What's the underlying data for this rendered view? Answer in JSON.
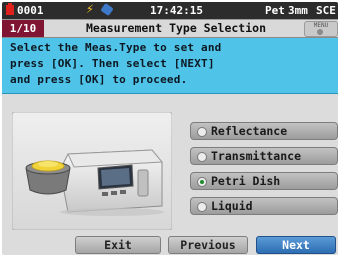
{
  "status_bar": {
    "count": "0001",
    "time": "17:42:15",
    "weekday": "Pet",
    "month": "3mm",
    "extra": "SCE",
    "colors": {
      "battery": "#e0201c",
      "bolt": "#f6c325",
      "plug": "#3e78c8"
    },
    "icons": [
      "battery-icon",
      "lightning-icon",
      "plug-icon"
    ]
  },
  "title_bar": {
    "page": "1/10",
    "title": "Measurement Type Selection",
    "menu_label": "MENU"
  },
  "instruction": {
    "lines": [
      "Select the Meas.Type to set and",
      "press [OK]. Then select [NEXT]",
      "and press [OK] to proceed."
    ]
  },
  "options": [
    {
      "label": "Reflectance",
      "selected": false
    },
    {
      "label": "Transmittance",
      "selected": false
    },
    {
      "label": "Petri Dish",
      "selected": true
    },
    {
      "label": "Liquid",
      "selected": false
    }
  ],
  "buttons": {
    "exit": "Exit",
    "previous": "Previous",
    "next": "Next"
  },
  "colors": {
    "page_badge": "#7f1433",
    "instruction_bg": "#4fc3e8",
    "next_button": "#2d6db2"
  }
}
